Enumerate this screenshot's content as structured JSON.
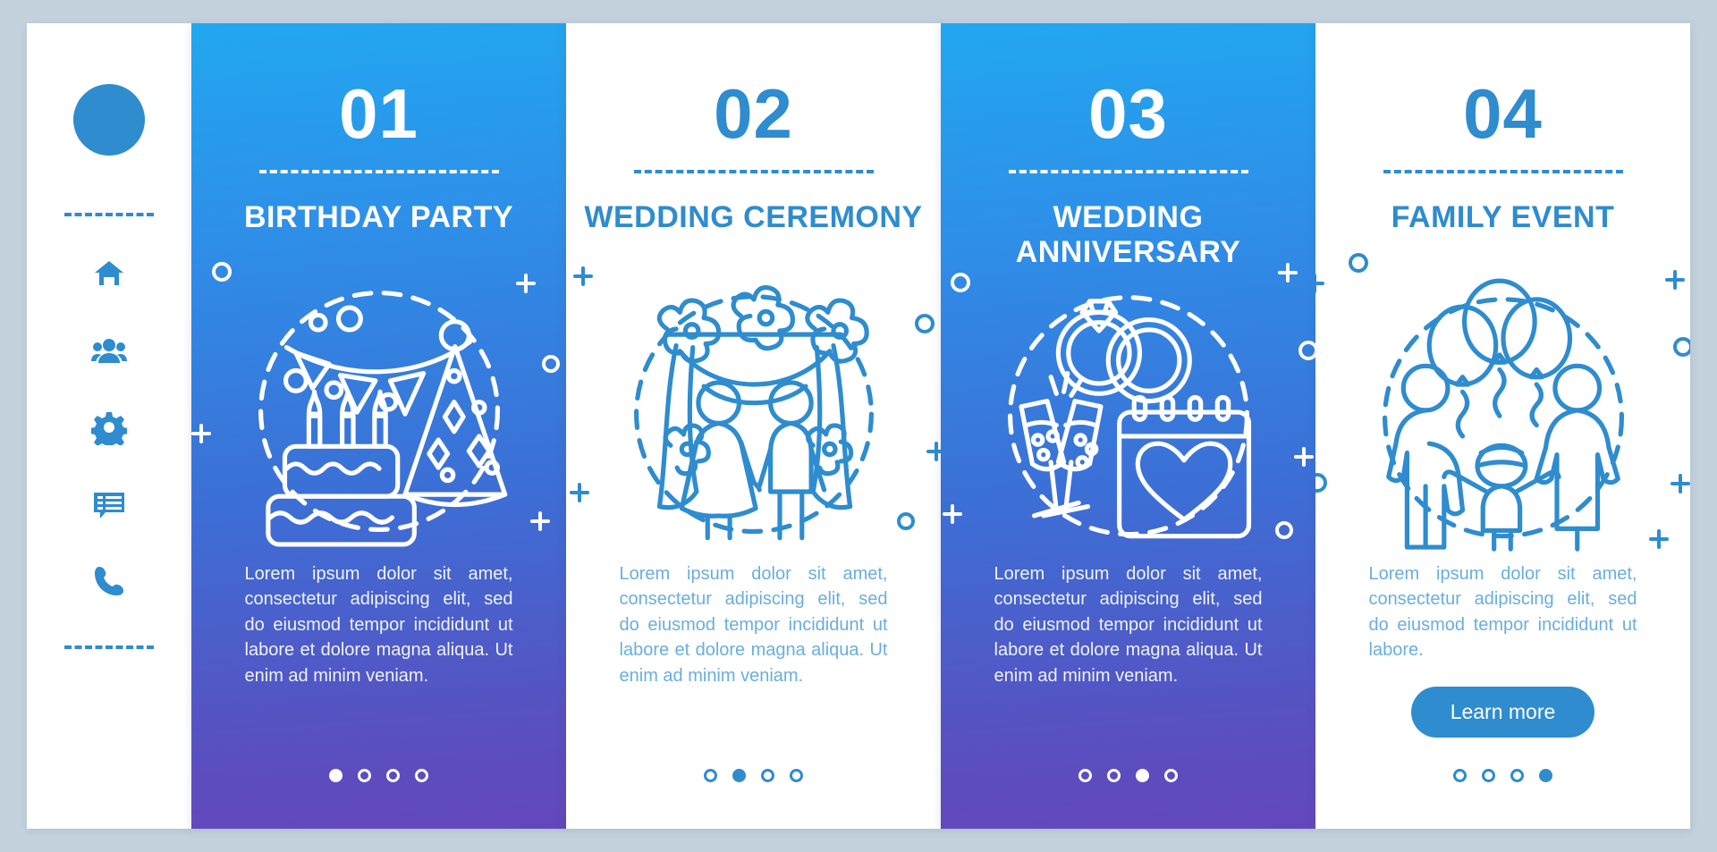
{
  "theme": {
    "background": "#c3d2dd",
    "accent": "#2e8ccf",
    "gradient_top": "#22a7f0",
    "gradient_bottom": "#6347bb",
    "card_white_bg": "#ffffff",
    "text_on_blue": "#ecf3fb",
    "text_on_white": "#6aaede"
  },
  "sidebar": {
    "avatar": {
      "name": "user-avatar"
    },
    "nav_items": [
      {
        "icon": "home-icon",
        "label": "Home"
      },
      {
        "icon": "users-icon",
        "label": "People"
      },
      {
        "icon": "gear-icon",
        "label": "Settings"
      },
      {
        "icon": "chat-icon",
        "label": "Messages"
      },
      {
        "icon": "phone-icon",
        "label": "Contact"
      }
    ]
  },
  "cards": [
    {
      "number": "01",
      "title": "Birthday Party",
      "body": "Lorem ipsum dolor sit amet, consectetur adipiscing elit, sed do eiusmod tempor incididunt ut labore et dolore magna aliqua. Ut enim ad minim veniam.",
      "style": "blue",
      "illustration": "birthday-cake-party-hat-bunting",
      "dots": {
        "count": 4,
        "active": 1
      },
      "button": null
    },
    {
      "number": "02",
      "title": "Wedding Ceremony",
      "body": "Lorem ipsum dolor sit amet, consectetur adipiscing elit, sed do eiusmod tempor incididunt ut labore et dolore magna aliqua. Ut enim ad minim veniam.",
      "style": "white",
      "illustration": "couple-under-floral-arch",
      "dots": {
        "count": 4,
        "active": 2
      },
      "button": null
    },
    {
      "number": "03",
      "title": "Wedding Anniversary",
      "body": "Lorem ipsum dolor sit amet, consectetur adipiscing elit, sed do eiusmod tempor incididunt ut labore et dolore magna aliqua. Ut enim ad minim veniam.",
      "style": "blue",
      "illustration": "wedding-rings-champagne-calendar-heart",
      "dots": {
        "count": 4,
        "active": 3
      },
      "button": null
    },
    {
      "number": "04",
      "title": "Family Event",
      "body": "Lorem ipsum dolor sit amet, consectetur adipiscing elit, sed do eiusmod tempor incididunt ut labore.",
      "style": "white",
      "illustration": "family-with-balloons",
      "dots": {
        "count": 4,
        "active": 4
      },
      "button": "Learn more"
    }
  ]
}
